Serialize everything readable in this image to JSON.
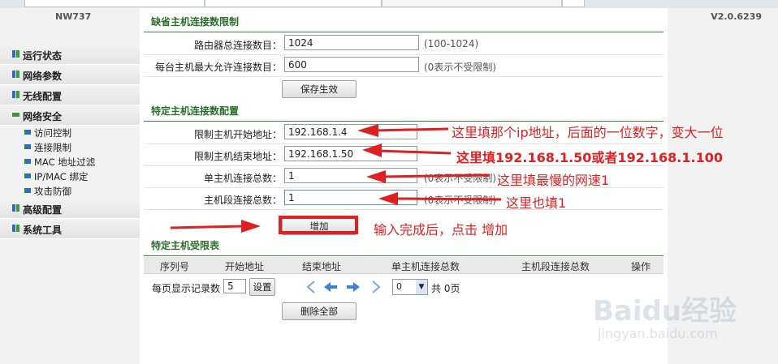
{
  "header": {
    "model": "NW737",
    "version": "V2.0.6239"
  },
  "sidebar": {
    "items": [
      {
        "label": "运行状态"
      },
      {
        "label": "网络参数"
      },
      {
        "label": "无线配置"
      },
      {
        "label": "网络安全"
      },
      {
        "label": "高级配置"
      },
      {
        "label": "系统工具"
      }
    ],
    "subitems": [
      {
        "label": "访问控制"
      },
      {
        "label": "连接限制"
      },
      {
        "label": "MAC 地址过滤"
      },
      {
        "label": "IP/MAC 绑定"
      },
      {
        "label": "攻击防御"
      }
    ]
  },
  "default_limit": {
    "title": "缺省主机连接数限制",
    "total_label": "路由器总连接数目：",
    "total_value": "1024",
    "total_hint": "(100-1024)",
    "per_host_label": "每台主机最大允许连接数目：",
    "per_host_value": "600",
    "per_host_hint": "(0表示不受限制)",
    "save_label": "保存生效"
  },
  "specific_config": {
    "title": "特定主机连接数配置",
    "start_label": "限制主机开始地址：",
    "start_value": "192.168.1.4",
    "end_label": "限制主机结束地址：",
    "end_value": "192.168.1.50",
    "single_label": "单主机连接总数：",
    "single_value": "1",
    "single_hint": "(0表示不受限制)",
    "segment_label": "主机段连接总数：",
    "segment_value": "1",
    "segment_hint": "(0表示不受限制)",
    "add_label": "增加"
  },
  "limited_table": {
    "title": "特定主机受限表",
    "columns": [
      "序列号",
      "开始地址",
      "结束地址",
      "单主机连接总数",
      "主机段连接总数",
      "操作"
    ],
    "per_page_label": "每页显示记录数",
    "per_page_value": "5",
    "set_label": "设置",
    "page_select": "0",
    "total_pages": "共 0页",
    "delete_all_label": "删除全部"
  },
  "annotations": {
    "a1": "这里填那个ip地址，后面的一位数字，变大一位",
    "a2": "这里填192.168.1.50或者192.168.1.100",
    "a3": "这里填最慢的网速1",
    "a4": "这里也填1",
    "a5": "输入完成后，点击 增加"
  },
  "watermark": {
    "logo": "Baidu经验",
    "url": "jingyan.baidu.com"
  },
  "colors": {
    "annotation": "#e02020",
    "section_title": "#2a6e2a",
    "accent_blue": "#2e6cc4"
  }
}
